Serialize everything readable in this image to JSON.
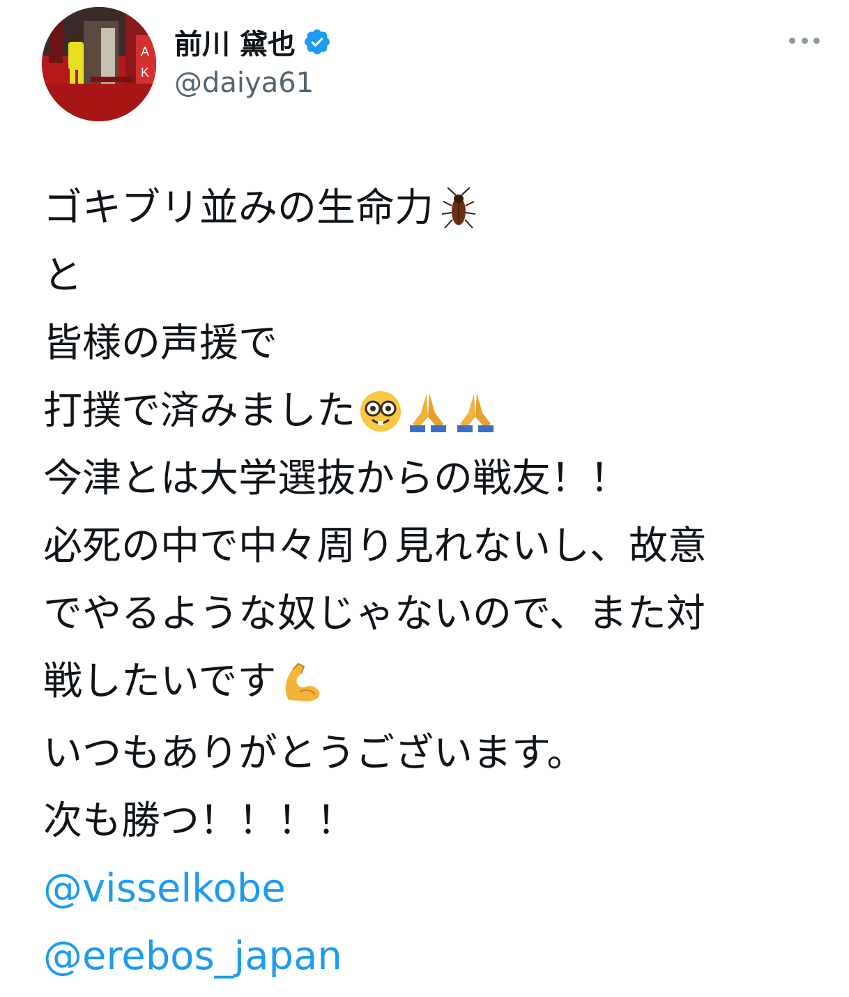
{
  "author": {
    "display_name": "前川 黛也",
    "handle": "@daiya61",
    "verified": true,
    "avatar_icon": "profile-photo"
  },
  "menu": {
    "icon": "more-horizontal-icon"
  },
  "tweet": {
    "lines": [
      {
        "text": "ゴキブリ並みの生命力",
        "emoji": [
          "cockroach-emoji"
        ]
      },
      {
        "text": "と",
        "emoji": []
      },
      {
        "text": "皆様の声援で",
        "emoji": []
      },
      {
        "text": "打撲で済みました",
        "emoji": [
          "nerd-face-emoji",
          "folded-hands-emoji",
          "folded-hands-emoji"
        ]
      },
      {
        "text": "今津とは大学選抜からの戦友！！",
        "emoji": []
      },
      {
        "text": "必死の中で中々周り見れないし、故意",
        "emoji": []
      },
      {
        "text": "でやるような奴じゃないので、また対",
        "emoji": []
      },
      {
        "text": "戦したいです",
        "emoji": [
          "flexed-biceps-emoji"
        ]
      },
      {
        "text": "いつもありがとうございます。",
        "emoji": []
      },
      {
        "text": "次も勝つ！！！！",
        "emoji": []
      }
    ],
    "mentions": [
      "@visselkobe",
      "@erebos_japan"
    ]
  },
  "colors": {
    "text": "#0f1419",
    "secondary": "#536471",
    "link": "#1d9bf0",
    "verified": "#1d9bf0"
  }
}
